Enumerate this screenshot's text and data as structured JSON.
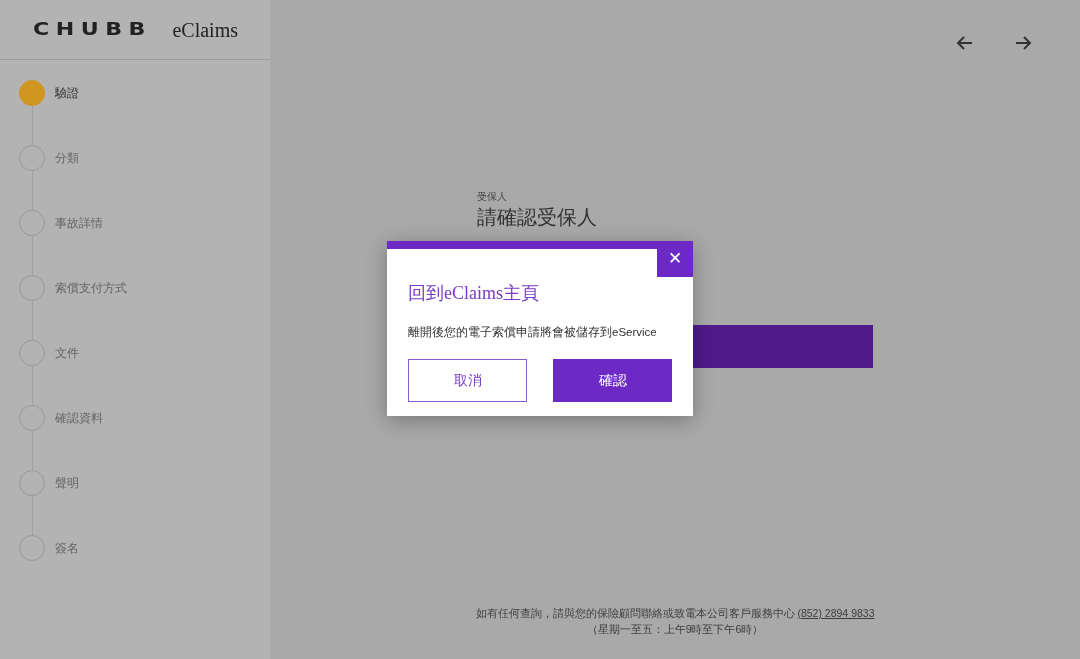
{
  "logo": {
    "brand": "CHUBB",
    "product": "eClaims"
  },
  "steps": [
    {
      "label": "驗證",
      "selected": true
    },
    {
      "label": "分類",
      "selected": false
    },
    {
      "label": "事故詳情",
      "selected": false
    },
    {
      "label": "索償支付方式",
      "selected": false
    },
    {
      "label": "文件",
      "selected": false
    },
    {
      "label": "確認資料",
      "selected": false
    },
    {
      "label": "聲明",
      "selected": false
    },
    {
      "label": "簽名",
      "selected": false
    }
  ],
  "page": {
    "eyebrow": "受保人",
    "heading": "請確認受保人"
  },
  "dialog": {
    "title": "回到eClaims主頁",
    "message": "離開後您的電子索償申請將會被儲存到eService",
    "close": "✕",
    "buttons": [
      {
        "label": "取消",
        "kind": "secondary"
      },
      {
        "label": "確認",
        "kind": "primary"
      }
    ]
  },
  "footer": {
    "text": "如有任何查詢，請與您的保險顧問聯絡或致電本公司客戶服務中心",
    "phone": "(852) 2894 9833",
    "hours": "（星期一至五：上午9時至下午6時）"
  }
}
